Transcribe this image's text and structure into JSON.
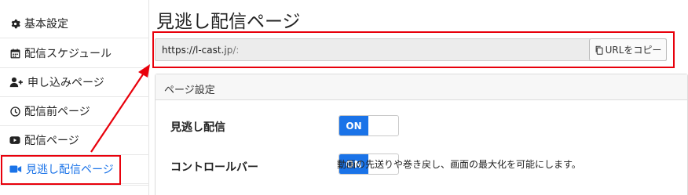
{
  "sidebar": {
    "items": [
      {
        "label": "基本設定",
        "icon": "gear-icon"
      },
      {
        "label": "配信スケジュール",
        "icon": "calendar-icon"
      },
      {
        "label": "申し込みページ",
        "icon": "user-plus-icon"
      },
      {
        "label": "配信前ページ",
        "icon": "clock-icon"
      },
      {
        "label": "配信ページ",
        "icon": "youtube-icon"
      },
      {
        "label": "見逃し配信ページ",
        "icon": "video-camera-icon"
      }
    ],
    "active_index": 5
  },
  "main": {
    "title": "見逃し配信ページ",
    "url": {
      "value": "https://l-cast.jp/:",
      "copy_label": "URLをコピー"
    },
    "settings": {
      "header": "ページ設定",
      "rows": [
        {
          "label": "見逃し配信",
          "toggle": "ON"
        },
        {
          "label": "コントロールバー",
          "toggle": "ON",
          "description": "動画の先送りや巻き戻し、画面の最大化を可能にします。"
        }
      ]
    }
  },
  "colors": {
    "accent": "#1a73e8",
    "annotation": "#e8000b"
  }
}
